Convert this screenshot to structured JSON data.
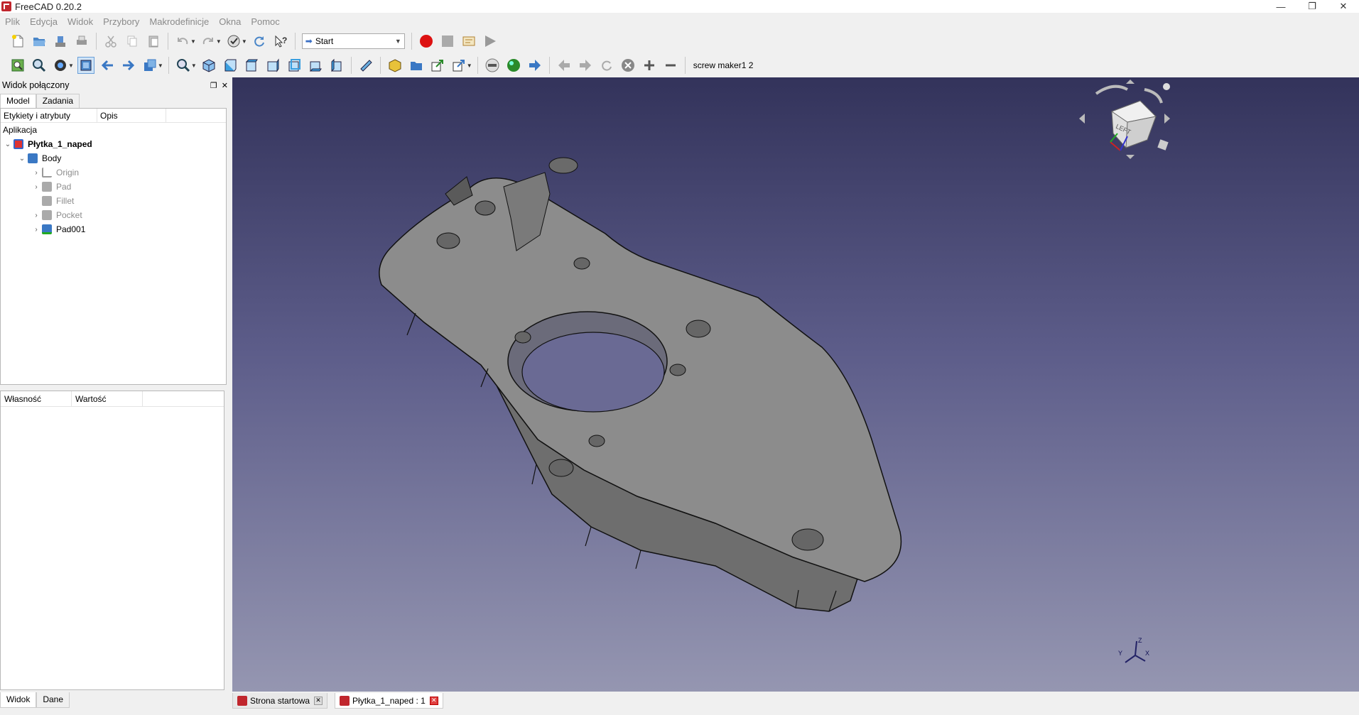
{
  "window": {
    "title": "FreeCAD 0.20.2",
    "minimize": "—",
    "restore": "❐",
    "close": "✕"
  },
  "menu": [
    "Plik",
    "Edycja",
    "Widok",
    "Przybory",
    "Makrodefinicje",
    "Okna",
    "Pomoc"
  ],
  "toolbar": {
    "workbench": "Start",
    "macro_label": "screw maker1 2"
  },
  "left_panel": {
    "title": "Widok połączony",
    "tabs": [
      "Model",
      "Zadania"
    ],
    "tree_headers": [
      "Etykiety i atrybuty",
      "Opis"
    ],
    "app_label": "Aplikacja",
    "doc_name": "Płytka_1_naped",
    "body": "Body",
    "features": [
      "Origin",
      "Pad",
      "Fillet",
      "Pocket",
      "Pad001"
    ],
    "prop_headers": [
      "Własność",
      "Wartość"
    ],
    "bottom_tabs": [
      "Widok",
      "Dane"
    ]
  },
  "nav_cube": {
    "face_label": "LEFT"
  },
  "doc_tabs": [
    {
      "label": "Strona startowa",
      "active": false
    },
    {
      "label": "Płytka_1_naped : 1",
      "active": true
    }
  ],
  "colors": {
    "viewport_top": "#33335b",
    "viewport_bottom": "#9596b1",
    "part": "#8c8c8c",
    "brand": "#c0262d"
  }
}
